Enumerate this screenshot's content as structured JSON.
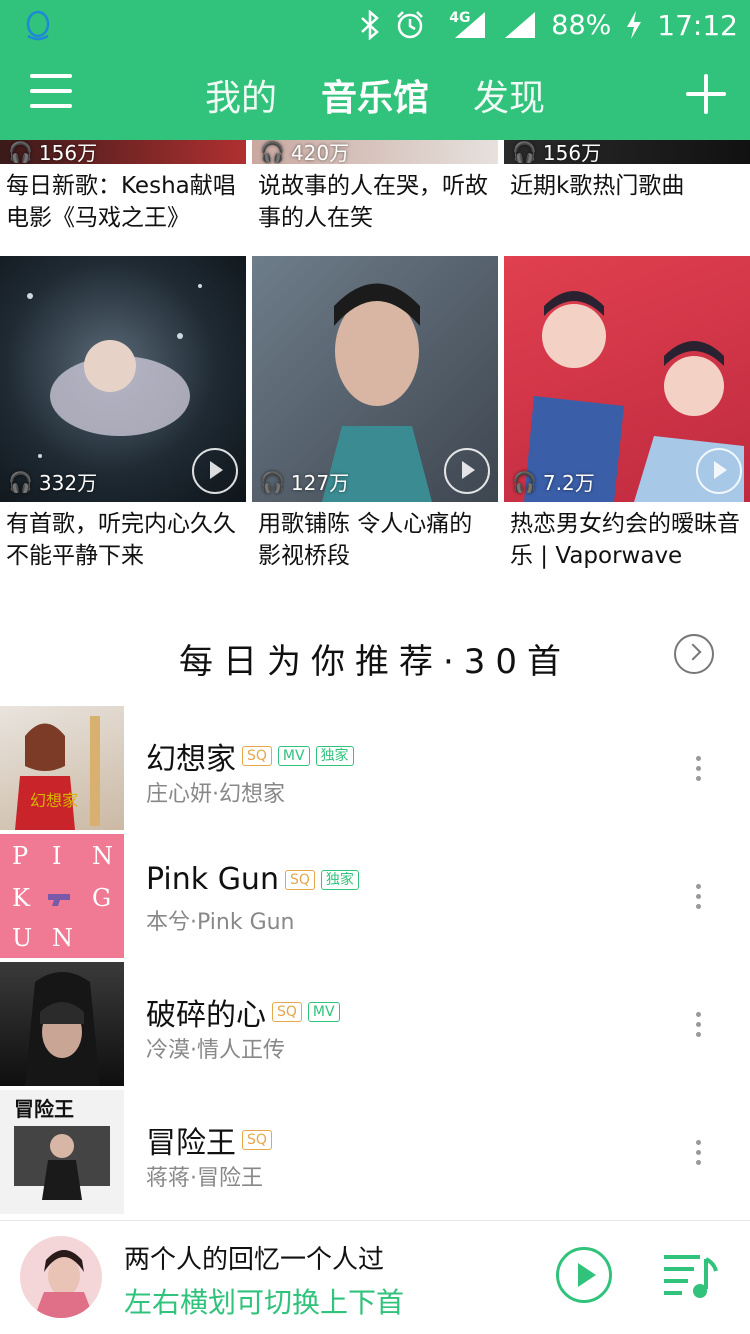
{
  "status_bar": {
    "app_icon": "qq-penguin-icon",
    "bluetooth_icon": "bluetooth-icon",
    "alarm_icon": "alarm-icon",
    "network": "4G",
    "battery": "88%",
    "charging_icon": "lightning-icon",
    "time": "17:12"
  },
  "app_bar": {
    "menu_icon": "hamburger-menu-icon",
    "tabs": [
      {
        "label": "我的"
      },
      {
        "label": "音乐馆"
      },
      {
        "label": "发现"
      }
    ],
    "active_tab": "音乐馆",
    "add_icon": "plus-icon"
  },
  "playlists_row1": [
    {
      "plays": "156万",
      "title": "每日新歌：Kesha献唱电影《马戏之王》"
    },
    {
      "plays": "420万",
      "title": "说故事的人在哭，听故事的人在笑"
    },
    {
      "plays": "156万",
      "title": "近期k歌热门歌曲"
    }
  ],
  "playlists_row2": [
    {
      "plays": "332万",
      "title": "有首歌，听完内心久久不能平静下来"
    },
    {
      "plays": "127万",
      "title": "用歌铺陈 令人心痛的影视桥段"
    },
    {
      "plays": "7.2万",
      "title": "热恋男女约会的暧昧音乐 | Vaporwave"
    }
  ],
  "recommend": {
    "title": "每日为你推荐·30首",
    "more_icon": "chevron-right-circle-icon"
  },
  "songs": [
    {
      "name": "幻想家",
      "sub": "庄心妍·幻想家",
      "tags": [
        "SQ",
        "MV",
        "独家"
      ]
    },
    {
      "name": "Pink Gun",
      "sub": "本兮·Pink Gun",
      "tags": [
        "SQ",
        "独家"
      ]
    },
    {
      "name": "破碎的心",
      "sub": "冷漠·情人正传",
      "tags": [
        "SQ",
        "MV"
      ]
    },
    {
      "name": "冒险王",
      "sub": "蒋蒋·冒险王",
      "tags": [
        "SQ"
      ]
    }
  ],
  "cover_text": {
    "pink_gun": [
      "P",
      "I",
      "N",
      "K",
      "G",
      "U",
      "N"
    ],
    "song1_art": "幻想家",
    "song4_art": "冒险王"
  },
  "player": {
    "title": "两个人的回忆一个人过",
    "hint": "左右横划可切换上下首",
    "play_icon": "play-circle-icon",
    "playlist_icon": "playlist-icon"
  },
  "colors": {
    "brand_green": "#31c27c",
    "sq_tag": "#e6a64a"
  }
}
